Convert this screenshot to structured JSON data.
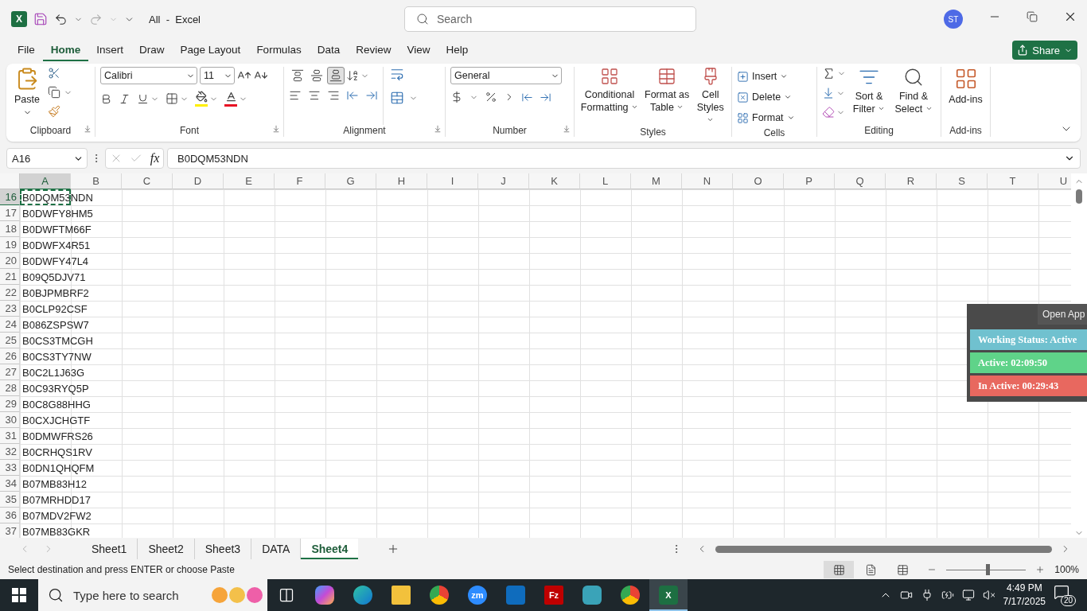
{
  "title_bar": {
    "logo_letter": "X",
    "document_title": "All  -  Excel",
    "search_placeholder": "Search",
    "avatar_initials": "ST"
  },
  "menu_tabs": [
    {
      "label": "File",
      "selected": false
    },
    {
      "label": "Home",
      "selected": true
    },
    {
      "label": "Insert",
      "selected": false
    },
    {
      "label": "Draw",
      "selected": false
    },
    {
      "label": "Page Layout",
      "selected": false
    },
    {
      "label": "Formulas",
      "selected": false
    },
    {
      "label": "Data",
      "selected": false
    },
    {
      "label": "Review",
      "selected": false
    },
    {
      "label": "View",
      "selected": false
    },
    {
      "label": "Help",
      "selected": false
    }
  ],
  "share_button": "Share",
  "ribbon": {
    "clipboard": {
      "label": "Clipboard",
      "paste": "Paste"
    },
    "font": {
      "label": "Font",
      "font_name": "Calibri",
      "font_size": "11"
    },
    "alignment": {
      "label": "Alignment",
      "vertical": [
        {
          "kind": "top",
          "selected": false
        },
        {
          "kind": "middle",
          "selected": false
        },
        {
          "kind": "bottom",
          "selected": true
        }
      ]
    },
    "number": {
      "label": "Number",
      "format": "General"
    },
    "styles": {
      "label": "Styles",
      "buttons": [
        "Conditional Formatting",
        "Format as Table",
        "Cell Styles"
      ]
    },
    "cells": {
      "label": "Cells",
      "buttons": [
        "Insert",
        "Delete",
        "Format"
      ]
    },
    "editing": {
      "label": "Editing",
      "buttons": [
        "Sort & Filter",
        "Find & Select"
      ]
    },
    "add_ins": {
      "label": "Add-ins",
      "button": "Add-ins"
    }
  },
  "formula_bar": {
    "name_box": "A16",
    "fx": "fx",
    "formula": "B0DQM53NDN"
  },
  "grid": {
    "columns": [
      "A",
      "B",
      "C",
      "D",
      "E",
      "F",
      "G",
      "H",
      "I",
      "J",
      "K",
      "L",
      "M",
      "N",
      "O",
      "P",
      "Q",
      "R",
      "S",
      "T",
      "U"
    ],
    "rows": [
      {
        "number": "16",
        "value": "B0DQM53NDN",
        "selected": true
      },
      {
        "number": "17",
        "value": "B0DWFY8HM5",
        "selected": false
      },
      {
        "number": "18",
        "value": "B0DWFTM66F",
        "selected": false
      },
      {
        "number": "19",
        "value": "B0DWFX4R51",
        "selected": false
      },
      {
        "number": "20",
        "value": "B0DWFY47L4",
        "selected": false
      },
      {
        "number": "21",
        "value": "B09Q5DJV71",
        "selected": false
      },
      {
        "number": "22",
        "value": "B0BJPMBRF2",
        "selected": false
      },
      {
        "number": "23",
        "value": "B0CLP92CSF",
        "selected": false
      },
      {
        "number": "24",
        "value": "B086ZSPSW7",
        "selected": false
      },
      {
        "number": "25",
        "value": "B0CS3TMCGH",
        "selected": false
      },
      {
        "number": "26",
        "value": "B0CS3TY7NW",
        "selected": false
      },
      {
        "number": "27",
        "value": "B0C2L1J63G",
        "selected": false
      },
      {
        "number": "28",
        "value": "B0C93RYQ5P",
        "selected": false
      },
      {
        "number": "29",
        "value": "B0C8G88HHG",
        "selected": false
      },
      {
        "number": "30",
        "value": "B0CXJCHGTF",
        "selected": false
      },
      {
        "number": "31",
        "value": "B0DMWFRS26",
        "selected": false
      },
      {
        "number": "32",
        "value": "B0CRHQS1RV",
        "selected": false
      },
      {
        "number": "33",
        "value": "B0DN1QHQFM",
        "selected": false
      },
      {
        "number": "34",
        "value": "B07MB83H12",
        "selected": false
      },
      {
        "number": "35",
        "value": "B07MRHDD17",
        "selected": false
      },
      {
        "number": "36",
        "value": "B07MDV2FW2",
        "selected": false
      },
      {
        "number": "37",
        "value": "B07MB83GKR",
        "selected": false
      }
    ]
  },
  "sheet_tabs": [
    {
      "label": "Sheet1",
      "selected": false
    },
    {
      "label": "Sheet2",
      "selected": false
    },
    {
      "label": "Sheet3",
      "selected": false
    },
    {
      "label": "DATA",
      "selected": false
    },
    {
      "label": "Sheet4",
      "selected": true
    }
  ],
  "status_bar": {
    "message": "Select destination and press ENTER or choose Paste",
    "views": [
      {
        "kind": "normal",
        "selected": true
      },
      {
        "kind": "page_layout",
        "selected": false
      },
      {
        "kind": "page_break",
        "selected": false
      }
    ],
    "zoom": {
      "level": 0.5,
      "reading": "100%"
    }
  },
  "tracker": {
    "open_button": "Open App",
    "entries": [
      {
        "text": "Working Status: Active",
        "color": "#70c1cf"
      },
      {
        "text": "Active: 02:09:50",
        "color": "#5fd389"
      },
      {
        "text": "In Active: 00:29:43",
        "color": "#e8685f"
      }
    ]
  },
  "taskbar": {
    "search_placeholder": "Type here to search",
    "apps": [
      {
        "kind": "task_view",
        "active": false
      },
      {
        "kind": "copilot",
        "active": false
      },
      {
        "kind": "edge",
        "active": false
      },
      {
        "kind": "explorer",
        "active": false
      },
      {
        "kind": "chrome",
        "active": false
      },
      {
        "kind": "zoom",
        "label": "zm",
        "active": false
      },
      {
        "kind": "outlook",
        "active": false
      },
      {
        "kind": "filezilla",
        "label": "Fz",
        "active": false
      },
      {
        "kind": "cube",
        "active": false
      },
      {
        "kind": "chrome_profile",
        "active": false
      },
      {
        "kind": "excel",
        "label": "X",
        "active": true
      }
    ],
    "time": "4:49 PM",
    "date": "7/17/2025",
    "notifications": "20"
  }
}
